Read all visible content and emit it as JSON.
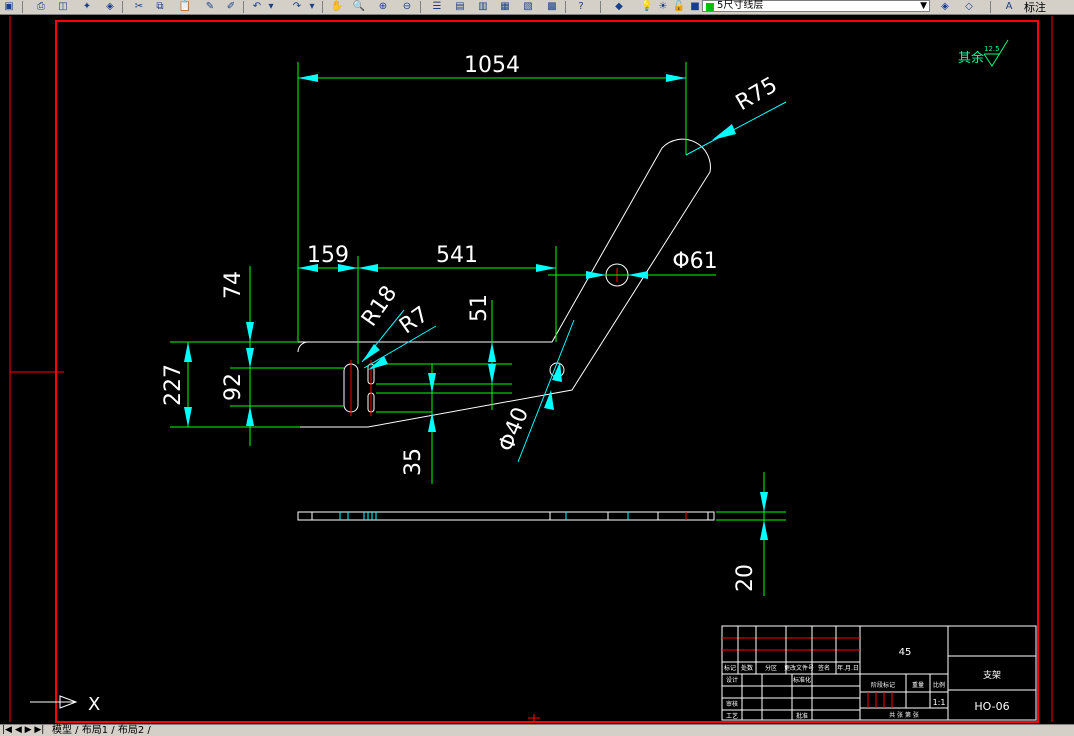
{
  "toolbar": {
    "layer_name": "5尺寸线层",
    "style_label": "标注"
  },
  "dimensions": {
    "overall_width": "1054",
    "radius_top": "R75",
    "left_offset": "159",
    "mid_length": "541",
    "hole_diameter": "Φ61",
    "height_top": "74",
    "height_total": "227",
    "height_slot": "92",
    "slot_r18": "R18",
    "slot_r7": "R7",
    "step_51": "51",
    "pin_diameter": "Φ40",
    "bottom_35": "35",
    "thickness": "20"
  },
  "surface_note": {
    "text": "其余",
    "roughness": "12.5"
  },
  "axis_label": "X",
  "title_block": {
    "material": "45",
    "part_name": "支架",
    "drawing_no": "HO-06",
    "scale": "1:1",
    "row_labels": [
      "标记",
      "处数",
      "分区",
      "更改文件号",
      "签名",
      "年.月.日"
    ],
    "design": "设计",
    "standardize": "标准化",
    "stage_label": "阶段标记",
    "weight": "重量",
    "ratio": "比例",
    "review": "审核",
    "process": "工艺",
    "approve": "批准",
    "sheets": "共  张  第  张"
  },
  "status_bar": {
    "nav": "|◀ ◀ ▶ ▶|",
    "tabs": "模型 / 布局1 / 布局2 /"
  },
  "colors": {
    "line_white": "#ffffff",
    "dim_green": "#00ff00",
    "dim_cyan": "#00ffff",
    "border_red": "#ff0000",
    "title_green": "#00ff80"
  }
}
